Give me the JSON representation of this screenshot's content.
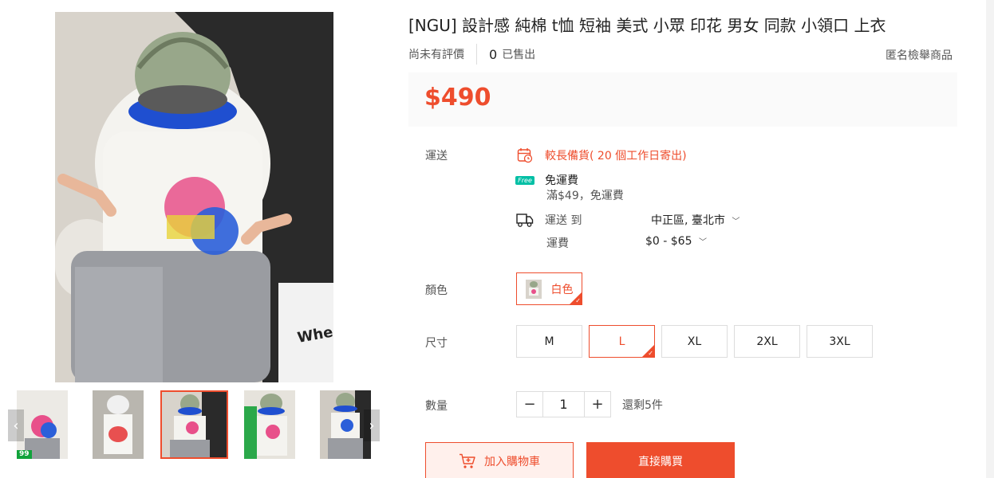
{
  "product": {
    "title": "[NGU] 設計感 純棉 t恤 短袖 美式 小眾 印花 男女 同款 小領口 上衣",
    "rating_text": "尚未有評價",
    "sold_count": "0",
    "sold_label": "已售出",
    "report_label": "匿名檢舉商品",
    "price": "$490"
  },
  "gallery": {
    "badge": "99",
    "prev_icon": "chevron-left-icon",
    "next_icon": "chevron-right-icon",
    "shirt_text": "When the I you"
  },
  "shipping": {
    "label": "運送",
    "pre_order": "較長備貨( 20 個工作日寄出)",
    "free_tag": "Free",
    "free_title": "免運費",
    "free_desc": "滿$49，免運費",
    "ship_to_label": "運送 到",
    "location": "中正區, 臺北市",
    "fee_label": "運費",
    "fee": "$0 - $65"
  },
  "variation_color": {
    "label": "顏色",
    "options": [
      "白色"
    ],
    "selected": "白色"
  },
  "variation_size": {
    "label": "尺寸",
    "options": [
      "M",
      "L",
      "XL",
      "2XL",
      "3XL"
    ],
    "selected": "L"
  },
  "quantity": {
    "label": "數量",
    "value": "1",
    "minus": "−",
    "plus": "+",
    "stock": "還剩5件"
  },
  "actions": {
    "add_to_cart": "加入購物車",
    "buy_now": "直接購買"
  },
  "colors": {
    "accent": "#ee4d2d",
    "price_bg": "#fafafa"
  }
}
